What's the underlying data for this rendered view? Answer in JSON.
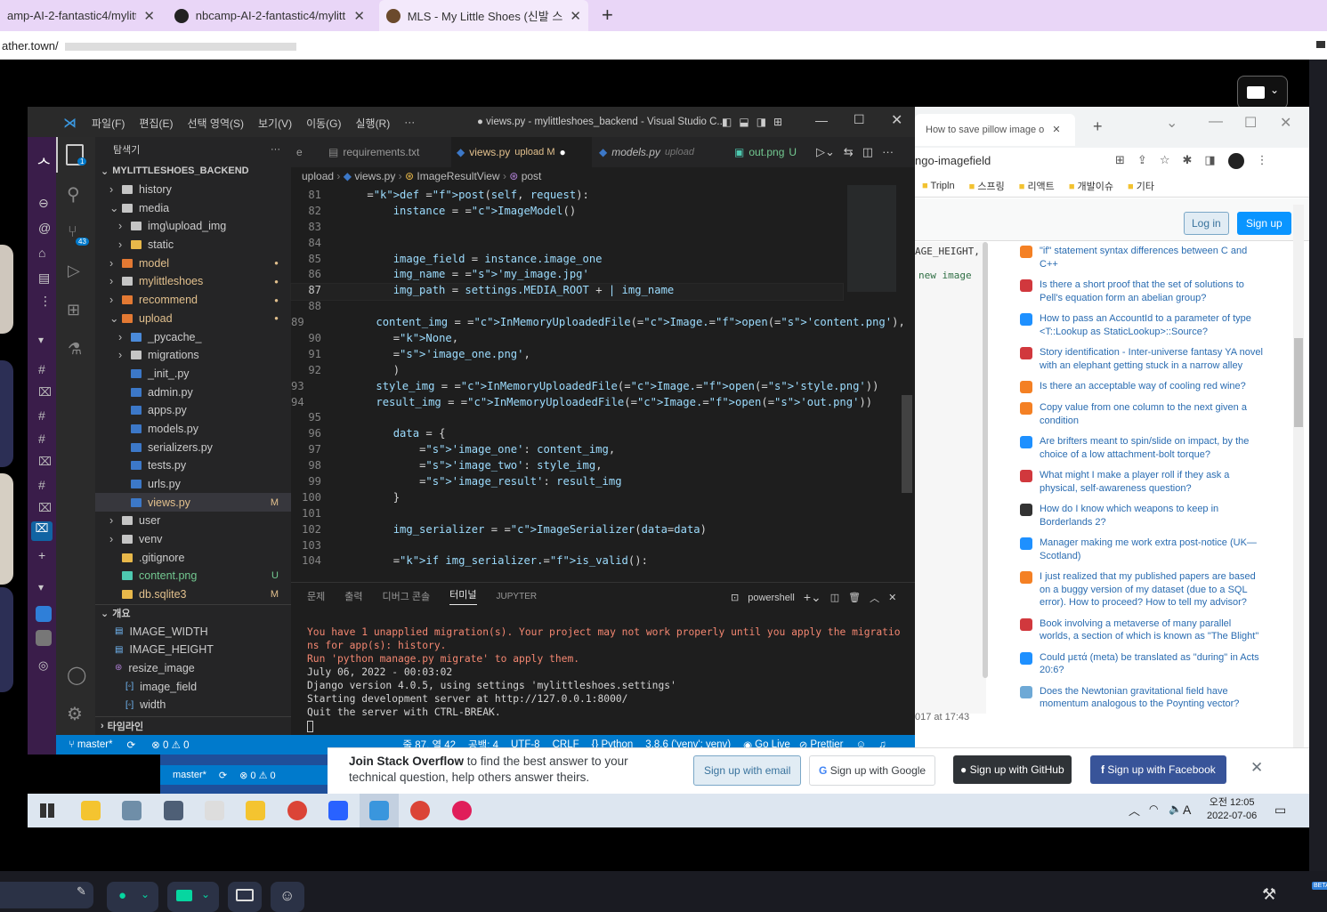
{
  "outer": {
    "tabs": [
      "amp-AI-2-fantastic4/mylittle",
      "nbcamp-AI-2-fantastic4/mylittle",
      "MLS - My Little Shoes (신발 스트"
    ],
    "url": "ather.town/",
    "plus": "+"
  },
  "vscode": {
    "menu": [
      "파일(F)",
      "편집(E)",
      "선택 영역(S)",
      "보기(V)",
      "이동(G)",
      "실행(R)",
      "···"
    ],
    "title": "● views.py - mylittleshoes_backend - Visual Studio C...",
    "explorer_title": "탐색기",
    "explorer_dots": "···",
    "project": "MYLITTLESHOES_BACKEND",
    "tree": [
      {
        "label": "history",
        "indent": 1,
        "caret": "›",
        "color": "#c5c5c5",
        "badge": ""
      },
      {
        "label": "media",
        "indent": 1,
        "caret": "⌄",
        "color": "#c5c5c5",
        "badge": ""
      },
      {
        "label": "img\\upload_img",
        "indent": 2,
        "caret": "›",
        "color": "#c5c5c5",
        "badge": ""
      },
      {
        "label": "static",
        "indent": 2,
        "caret": "›",
        "color": "#e8b84a",
        "badge": ""
      },
      {
        "label": "model",
        "indent": 1,
        "caret": "›",
        "color": "#e37933",
        "badge": "●",
        "text": "#e2c08d"
      },
      {
        "label": "mylittleshoes",
        "indent": 1,
        "caret": "›",
        "color": "#c5c5c5",
        "badge": "●",
        "text": "#e2c08d"
      },
      {
        "label": "recommend",
        "indent": 1,
        "caret": "›",
        "color": "#e37933",
        "badge": "●",
        "text": "#e2c08d"
      },
      {
        "label": "upload",
        "indent": 1,
        "caret": "⌄",
        "color": "#e37933",
        "badge": "●",
        "text": "#e2c08d"
      },
      {
        "label": "_pycache_",
        "indent": 2,
        "caret": "›",
        "color": "#4a8ad9",
        "badge": ""
      },
      {
        "label": "migrations",
        "indent": 2,
        "caret": "›",
        "color": "#c5c5c5",
        "badge": ""
      },
      {
        "label": "_init_.py",
        "indent": 2,
        "caret": "",
        "color": "#3c78c8",
        "badge": ""
      },
      {
        "label": "admin.py",
        "indent": 2,
        "caret": "",
        "color": "#3c78c8",
        "badge": ""
      },
      {
        "label": "apps.py",
        "indent": 2,
        "caret": "",
        "color": "#3c78c8",
        "badge": ""
      },
      {
        "label": "models.py",
        "indent": 2,
        "caret": "",
        "color": "#3c78c8",
        "badge": ""
      },
      {
        "label": "serializers.py",
        "indent": 2,
        "caret": "",
        "color": "#3c78c8",
        "badge": ""
      },
      {
        "label": "tests.py",
        "indent": 2,
        "caret": "",
        "color": "#3c78c8",
        "badge": ""
      },
      {
        "label": "urls.py",
        "indent": 2,
        "caret": "",
        "color": "#3c78c8",
        "badge": ""
      },
      {
        "label": "views.py",
        "indent": 2,
        "caret": "",
        "color": "#3c78c8",
        "badge": "M",
        "text": "#e2c08d",
        "active": true
      },
      {
        "label": "user",
        "indent": 1,
        "caret": "›",
        "color": "#c5c5c5",
        "badge": ""
      },
      {
        "label": "venv",
        "indent": 1,
        "caret": "›",
        "color": "#c5c5c5",
        "badge": ""
      },
      {
        "label": ".gitignore",
        "indent": 1,
        "caret": "",
        "color": "#e8b84a",
        "badge": ""
      },
      {
        "label": "content.png",
        "indent": 1,
        "caret": "",
        "color": "#4ec9b0",
        "badge": "U",
        "text": "#73c991"
      },
      {
        "label": "db.sqlite3",
        "indent": 1,
        "caret": "",
        "color": "#e8b84a",
        "badge": "M",
        "text": "#e2c08d"
      }
    ],
    "outline_title": "개요",
    "outline": [
      {
        "label": "IMAGE_WIDTH",
        "indent": 1
      },
      {
        "label": "IMAGE_HEIGHT",
        "indent": 1
      },
      {
        "label": "resize_image",
        "indent": 1
      },
      {
        "label": "image_field",
        "indent": 2
      },
      {
        "label": "width",
        "indent": 2
      }
    ],
    "timeline": "타임라인",
    "tabs": [
      {
        "label": "e",
        "color": "#999"
      },
      {
        "label": "requirements.txt",
        "color": "#999"
      },
      {
        "label": "views.py",
        "suffix": "upload M",
        "color": "#e2c08d",
        "active": true
      },
      {
        "label": "models.py",
        "suffix": "upload",
        "color": "#999",
        "italic": true
      },
      {
        "label": "out.png",
        "suffix": "U",
        "color": "#73c991"
      }
    ],
    "breadcrumb": [
      "upload",
      "views.py",
      "ImageResultView",
      "post"
    ],
    "code": [
      {
        "n": "81",
        "t": "    def post(self, request):"
      },
      {
        "n": "82",
        "t": "        instance = ImageModel()"
      },
      {
        "n": "83",
        "t": ""
      },
      {
        "n": "84",
        "t": ""
      },
      {
        "n": "85",
        "t": "        image_field = instance.image_one"
      },
      {
        "n": "86",
        "t": "        img_name = 'my_image.jpg'"
      },
      {
        "n": "87",
        "t": "        img_path = settings.MEDIA_ROOT + | img_name"
      },
      {
        "n": "88",
        "t": ""
      },
      {
        "n": "89",
        "t": "        content_img = InMemoryUploadedFile(Image.open('content.png'),"
      },
      {
        "n": "90",
        "t": "        None,"
      },
      {
        "n": "91",
        "t": "        'image_one.png',"
      },
      {
        "n": "92",
        "t": "        )"
      },
      {
        "n": "93",
        "t": "        style_img = InMemoryUploadedFile(Image.open('style.png'))"
      },
      {
        "n": "94",
        "t": "        result_img = InMemoryUploadedFile(Image.open('out.png'))"
      },
      {
        "n": "95",
        "t": ""
      },
      {
        "n": "96",
        "t": "        data = {"
      },
      {
        "n": "97",
        "t": "            'image_one': content_img,"
      },
      {
        "n": "98",
        "t": "            'image_two': style_img,"
      },
      {
        "n": "99",
        "t": "            'image_result': result_img"
      },
      {
        "n": "100",
        "t": "        }"
      },
      {
        "n": "101",
        "t": ""
      },
      {
        "n": "102",
        "t": "        img_serializer = ImageSerializer(data=data)"
      },
      {
        "n": "103",
        "t": ""
      },
      {
        "n": "104",
        "t": "        if img_serializer.is_valid():"
      }
    ],
    "panel_tabs": [
      "문제",
      "출력",
      "디버그 콘솔",
      "터미널",
      "JUPYTER"
    ],
    "shell": "powershell",
    "terminal": [
      {
        "t": "You have 1 unapplied migration(s). Your project may not work properly until you apply the migratio",
        "c": "r"
      },
      {
        "t": "ns for app(s): history.",
        "c": "r"
      },
      {
        "t": "Run 'python manage.py migrate' to apply them.",
        "c": "r"
      },
      {
        "t": "July 06, 2022 - 00:03:02",
        "c": "w"
      },
      {
        "t": "Django version 4.0.5, using settings 'mylittleshoes.settings'",
        "c": "w"
      },
      {
        "t": "Starting development server at http://127.0.0.1:8000/",
        "c": "w"
      },
      {
        "t": "Quit the server with CTRL-BREAK.",
        "c": "w"
      }
    ],
    "status": {
      "branch": "master*",
      "sync": "⟳",
      "problems": "⊗ 0 ⚠ 0",
      "position": "줄 87, 열 42",
      "spaces": "공백: 4",
      "encoding": "UTF-8",
      "eol": "CRLF",
      "lang": "{} Python",
      "interp": "3.8.6 ('venv': venv)",
      "golive": "Go Live",
      "prettier": "Prettier"
    },
    "badge_scm": "43",
    "badge_files": "1"
  },
  "browser": {
    "tab": "How to save pillow image o",
    "url": "ngo-imagefield",
    "bookmarks": [
      "Tripln",
      "스프링",
      "리액트",
      "개발이슈",
      "기타"
    ],
    "login": "Log in",
    "signup": "Sign up",
    "code_peek": [
      "AGE_HEIGHT,",
      "new image"
    ],
    "date_peek": "017 at 17:43",
    "hot_questions": [
      "\"if\" statement syntax differences between C and C++",
      "Is there a short proof that the set of solutions to Pell's equation form an abelian group?",
      "How to pass an AccountId to a parameter of type <T::Lookup as StaticLookup>::Source?",
      "Story identification - Inter-universe fantasy YA novel with an elephant getting stuck in a narrow alley",
      "Is there an acceptable way of cooling red wine?",
      "Copy value from one column to the next given a condition",
      "Are brifters meant to spin/slide on impact, by the choice of a low attachment-bolt torque?",
      "What might I make a player roll if they ask a physical, self-awareness question?",
      "How do I know which weapons to keep in Borderlands 2?",
      "Manager making me work extra post-notice (UK—Scotland)",
      "I just realized that my published papers are based on a buggy version of my dataset (due to a SQL error). How to proceed? How to tell my advisor?",
      "Book involving a metaverse of many parallel worlds, a section of which is known as \"The Blight\"",
      "Could μετά (meta) be translated as \"during\" in Acts 20:6?",
      "Does the Newtonian gravitational field have momentum analogous to the Poynting vector?"
    ],
    "join_bold": "Join Stack Overflow",
    "join_rest": " to find the best answer to your technical question, help others answer theirs.",
    "signup_email": "Sign up with email",
    "signup_google": "Sign up with Google",
    "signup_github": "Sign up with GitHub",
    "signup_facebook": "Sign up with Facebook"
  },
  "behind_status": {
    "branch": "master*",
    "problems": "⊗ 0 ⚠ 0"
  },
  "taskbar": {
    "time": "오전 12:05",
    "date": "2022-07-06",
    "lang": "A"
  },
  "zoom": {
    "beta": "BETA"
  }
}
